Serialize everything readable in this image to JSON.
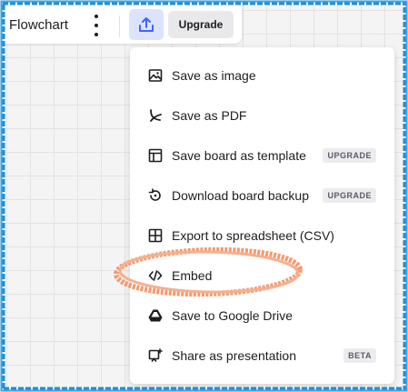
{
  "topbar": {
    "board_name": "Flowchart",
    "upgrade_label": "Upgrade"
  },
  "export_menu": {
    "items": [
      {
        "label": "Save as image",
        "icon": "image-icon",
        "badge": ""
      },
      {
        "label": "Save as PDF",
        "icon": "pdf-icon",
        "badge": ""
      },
      {
        "label": "Save board as template",
        "icon": "template-icon",
        "badge": "UPGRADE"
      },
      {
        "label": "Download board backup",
        "icon": "backup-icon",
        "badge": "UPGRADE"
      },
      {
        "label": "Export to spreadsheet (CSV)",
        "icon": "table-icon",
        "badge": ""
      },
      {
        "label": "Embed",
        "icon": "code-icon",
        "badge": ""
      },
      {
        "label": "Save to Google Drive",
        "icon": "google-drive-icon",
        "badge": ""
      },
      {
        "label": "Share as presentation",
        "icon": "presentation-icon",
        "badge": "BETA"
      }
    ]
  },
  "colors": {
    "accent": "#4262ff",
    "export_button_bg": "#dbe3ff",
    "frame": "#1e8fd6",
    "annotation": "#f39a6e"
  }
}
